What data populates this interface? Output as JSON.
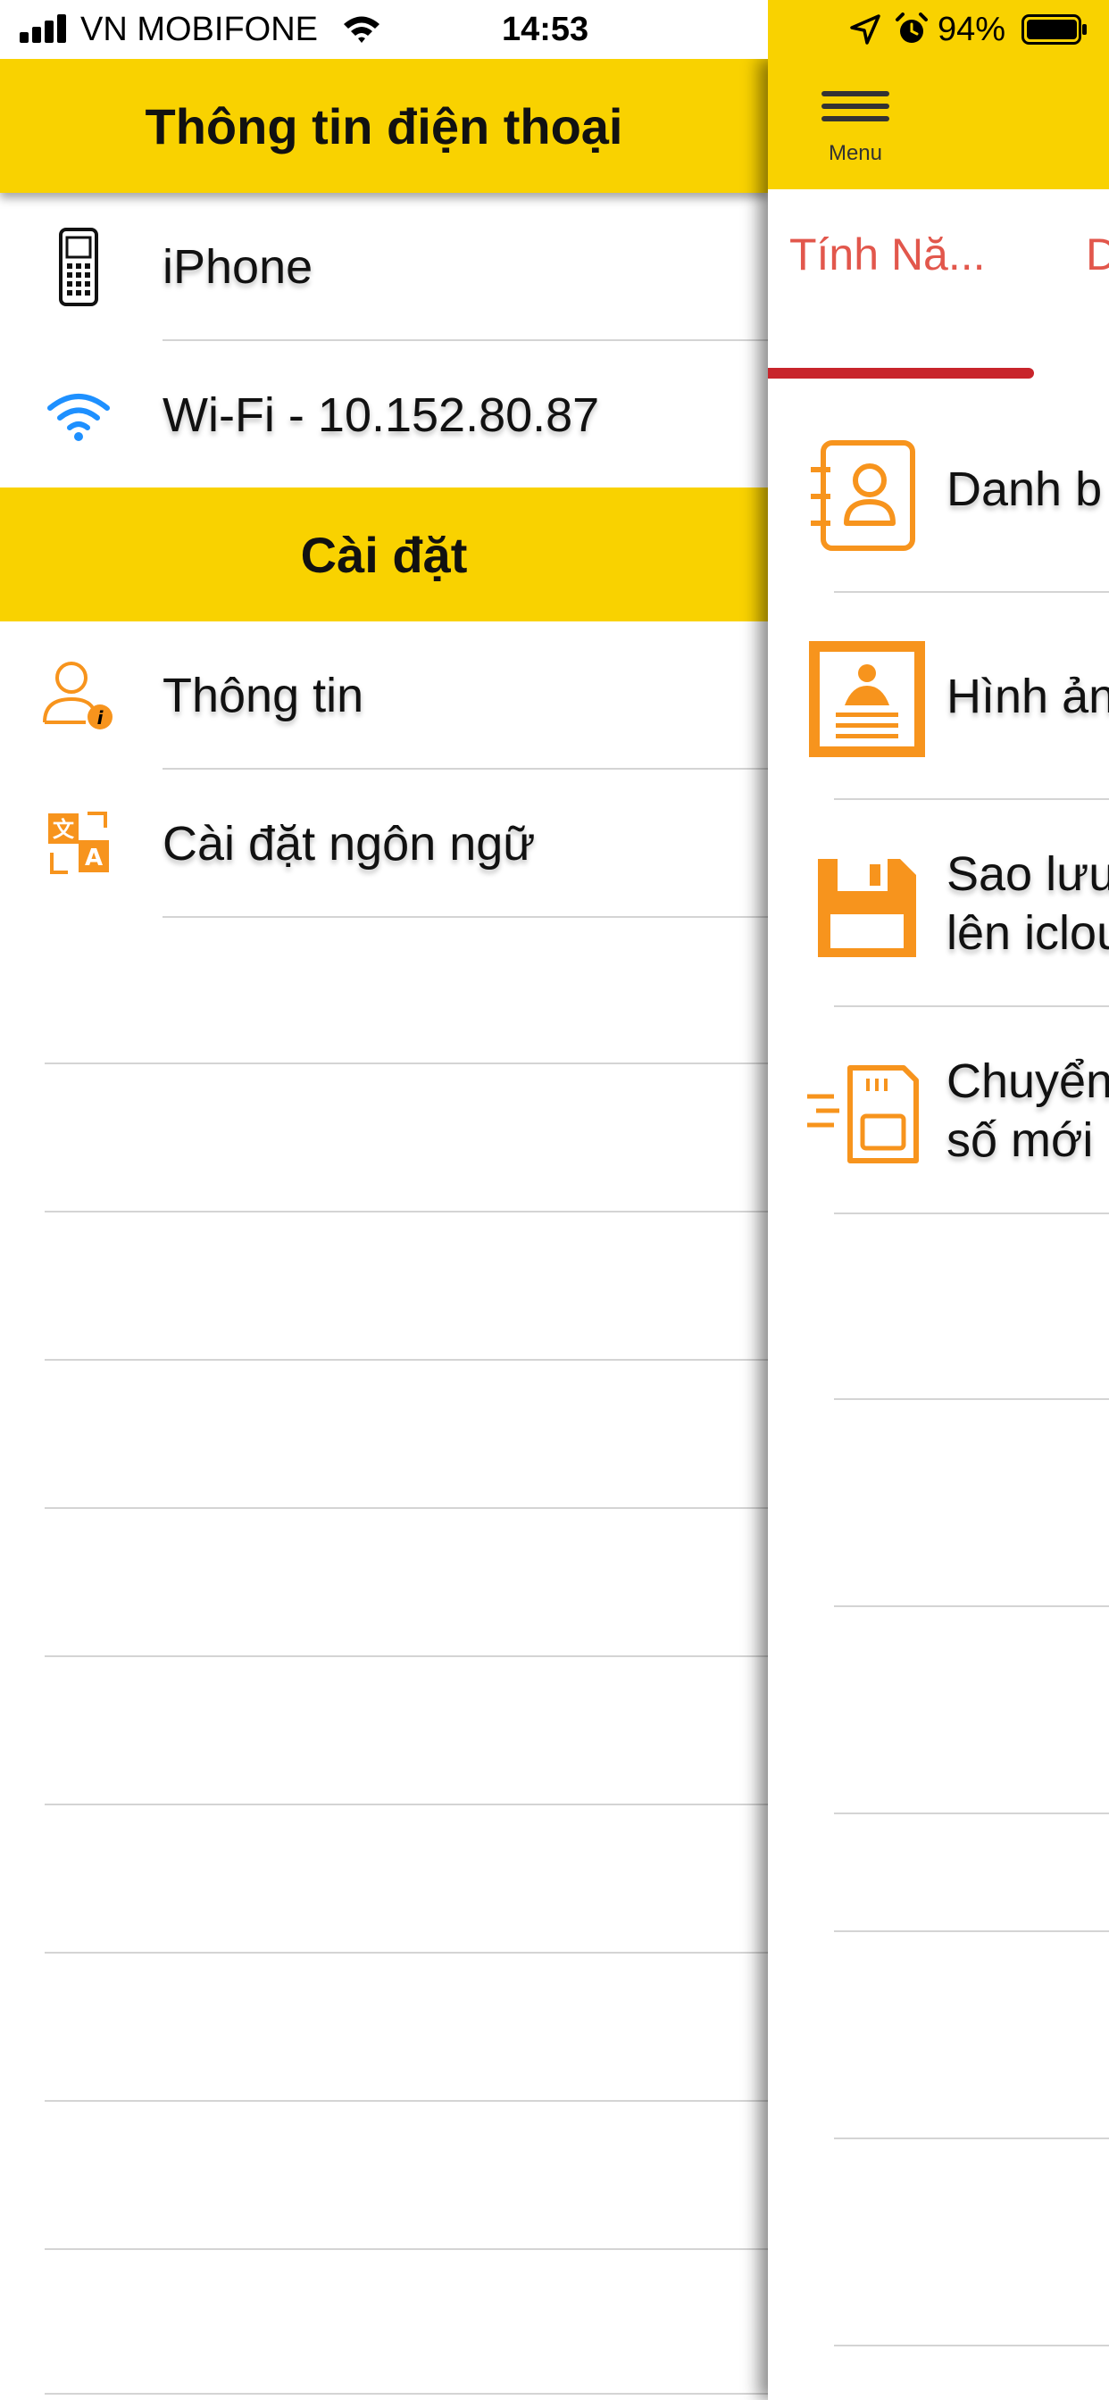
{
  "status_bar": {
    "carrier": "VN MOBIFONE",
    "time": "14:53",
    "battery": "94%",
    "icons": [
      "signal-bars-icon",
      "wifi-icon",
      "location-arrow-icon",
      "alarm-clock-icon",
      "battery-icon"
    ]
  },
  "side_menu": {
    "title": "Thông tin điện thoại",
    "device_items": [
      {
        "label": "iPhone",
        "icon": "phone-icon"
      },
      {
        "label": "Wi-Fi - 10.152.80.87",
        "icon": "wifi-icon"
      }
    ],
    "settings_title": "Cài đặt",
    "settings_items": [
      {
        "label": "Thông tin",
        "icon": "user-info-icon"
      },
      {
        "label": "Cài đặt ngôn ngữ",
        "icon": "translate-icon"
      }
    ]
  },
  "main": {
    "menu_caption": "Menu",
    "tabs": [
      {
        "label": "Tính Nă...",
        "active": true
      },
      {
        "label": "D",
        "active": false
      }
    ],
    "features": [
      {
        "lines": [
          "Danh b"
        ],
        "icon": "contacts-book-icon"
      },
      {
        "lines": [
          "Hình ản"
        ],
        "icon": "photo-icon"
      },
      {
        "lines": [
          "Sao lưu",
          "lên iclou"
        ],
        "icon": "save-disk-icon"
      },
      {
        "lines": [
          "Chuyển",
          "số mới"
        ],
        "icon": "sim-card-icon"
      }
    ]
  },
  "colors": {
    "header_yellow": "#f9d200",
    "accent_orange": "#f7941d",
    "tab_red": "#e2574c",
    "indicator_red": "#c8242b",
    "wifi_blue": "#1e90ff"
  }
}
